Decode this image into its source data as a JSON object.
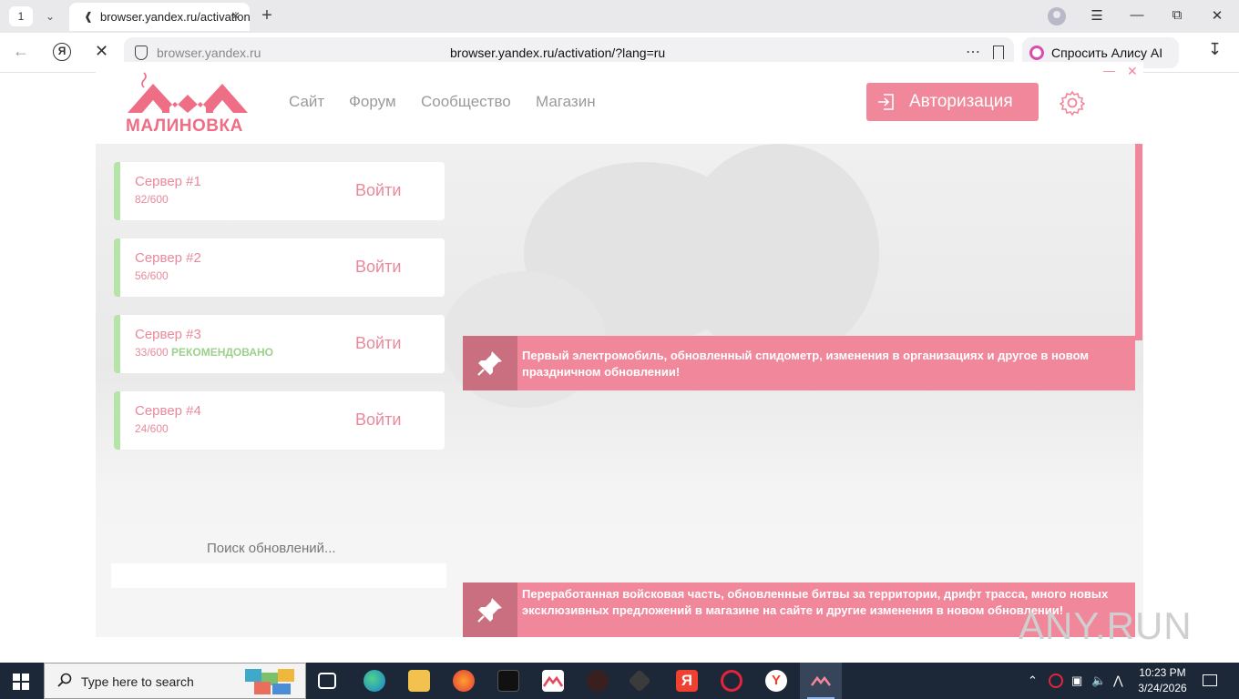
{
  "browser": {
    "tab_count": "1",
    "tab_title": "browser.yandex.ru/activation",
    "url_domain": "browser.yandex.ru",
    "url_full": "browser.yandex.ru/activation/?lang=ru",
    "alice_label": "Спросить Алису AI"
  },
  "app": {
    "logo_text": "МАЛИНОВКА",
    "nav": [
      "Сайт",
      "Форум",
      "Сообщество",
      "Магазин"
    ],
    "auth_label": "Авторизация",
    "servers": [
      {
        "name": "Сервер #1",
        "count": "82/600",
        "badge": "",
        "join": "Войти"
      },
      {
        "name": "Сервер #2",
        "count": "56/600",
        "badge": "",
        "join": "Войти"
      },
      {
        "name": "Сервер #3",
        "count": "33/600",
        "badge": "РЕКОМЕНДОВАНО",
        "join": "Войти"
      },
      {
        "name": "Сервер #4",
        "count": "24/600",
        "badge": "",
        "join": "Войти"
      }
    ],
    "update_status": "Поиск обновлений...",
    "news": [
      "Первый электромобиль, обновленный спидометр, изменения в организациях и другое в новом праздничном обновлении!",
      "Переработанная войсковая часть, обновленные битвы за территории, дрифт трасса, много новых эксклюзивных предложений в магазине на сайте и другие изменения в новом обновлении!"
    ],
    "accent_color": "#f1879b",
    "ok_color": "#b6e3a7"
  },
  "watermark": "ANY.RUN",
  "taskbar": {
    "search_placeholder": "Type here to search",
    "time": "10:23 PM",
    "date": "3/24/2026"
  }
}
